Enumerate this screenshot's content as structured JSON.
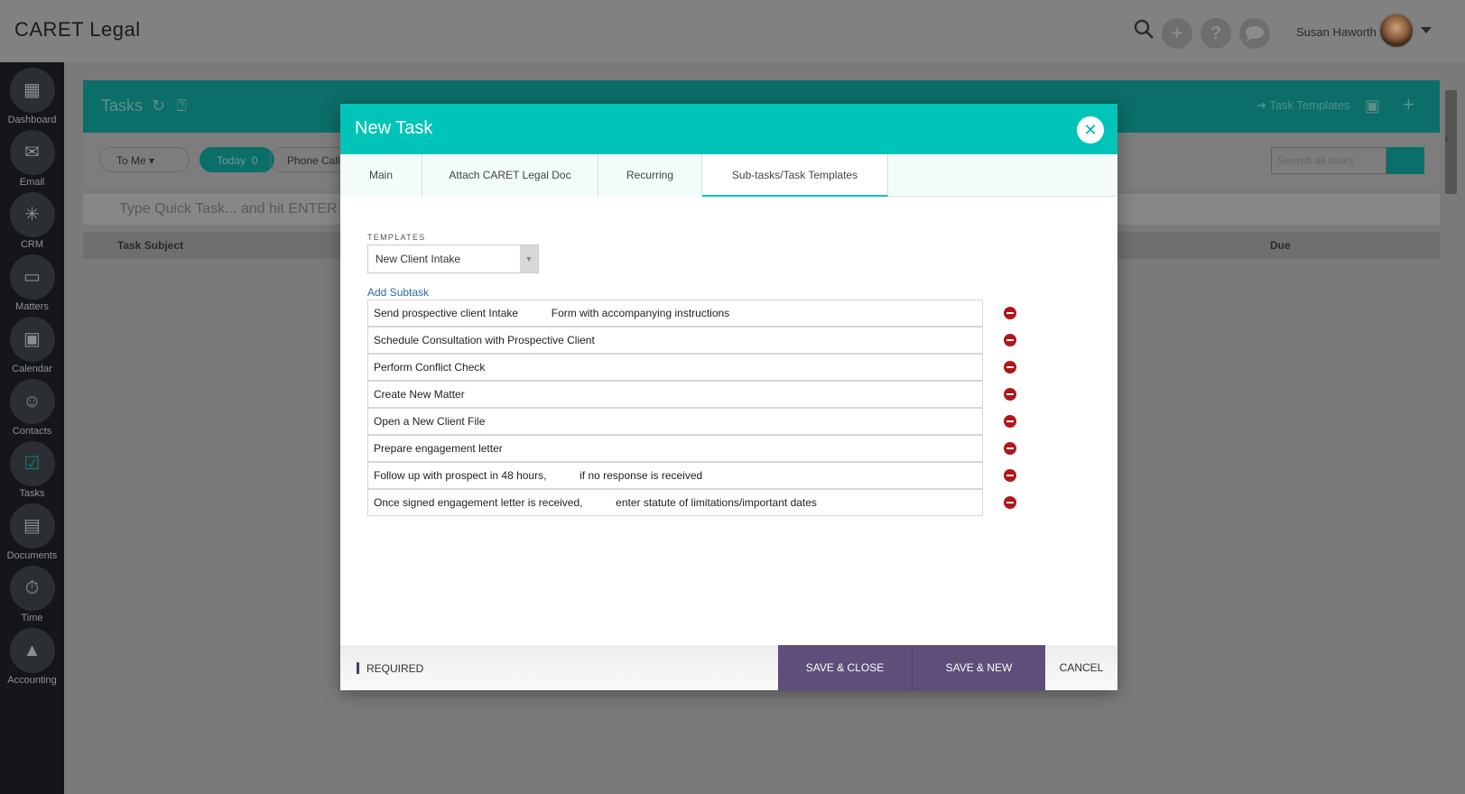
{
  "app": {
    "logo": "CARET Legal",
    "user_name": "Susan Haworth"
  },
  "sidebar": {
    "items": [
      {
        "label": "Dashboard",
        "icon": "dashboard-icon"
      },
      {
        "label": "Email",
        "icon": "email-icon"
      },
      {
        "label": "CRM",
        "icon": "crm-icon"
      },
      {
        "label": "Matters",
        "icon": "briefcase-icon"
      },
      {
        "label": "Calendar",
        "icon": "calendar-icon"
      },
      {
        "label": "Contacts",
        "icon": "contacts-icon"
      },
      {
        "label": "Tasks",
        "icon": "tasks-icon"
      },
      {
        "label": "Documents",
        "icon": "documents-icon"
      },
      {
        "label": "Time",
        "icon": "time-icon"
      },
      {
        "label": "Accounting",
        "icon": "accounting-icon"
      }
    ],
    "active": "Tasks"
  },
  "tasks_page": {
    "title": "Tasks",
    "task_templates_link": "Task Templates",
    "filters": {
      "to_me": "To Me",
      "today": "Today",
      "today_count": "0",
      "phone_calls": "Phone Calls"
    },
    "search_placeholder": "Search all tasks",
    "quick_task_placeholder": "Type Quick Task... and hit ENTER",
    "columns": {
      "subject": "Task Subject",
      "due": "Due"
    }
  },
  "modal": {
    "title": "New Task",
    "tabs": [
      {
        "label": "Main"
      },
      {
        "label": "Attach CARET Legal Doc"
      },
      {
        "label": "Recurring"
      },
      {
        "label": "Sub-tasks/Task Templates"
      }
    ],
    "active_tab": "Sub-tasks/Task Templates",
    "templates_label": "TEMPLATES",
    "template_selected": "New Client Intake",
    "add_subtask": "Add Subtask",
    "subtasks": [
      "Send prospective client Intake           Form with accompanying instructions",
      "Schedule Consultation with Prospective Client",
      "Perform Conflict Check",
      "Create New Matter",
      "Open a New Client File",
      "Prepare engagement letter",
      "Follow up with prospect in 48 hours,           if no response is received",
      "Once signed engagement letter is received,           enter statute of limitations/important dates"
    ],
    "footer": {
      "required": "REQUIRED",
      "save_close": "SAVE & CLOSE",
      "save_new": "SAVE & NEW",
      "cancel": "CANCEL"
    }
  },
  "colors": {
    "modal_header": "#00c4b8",
    "primary_button": "#5e4e79",
    "remove_icon": "#b0161a",
    "sidebar_bg": "#141619"
  }
}
